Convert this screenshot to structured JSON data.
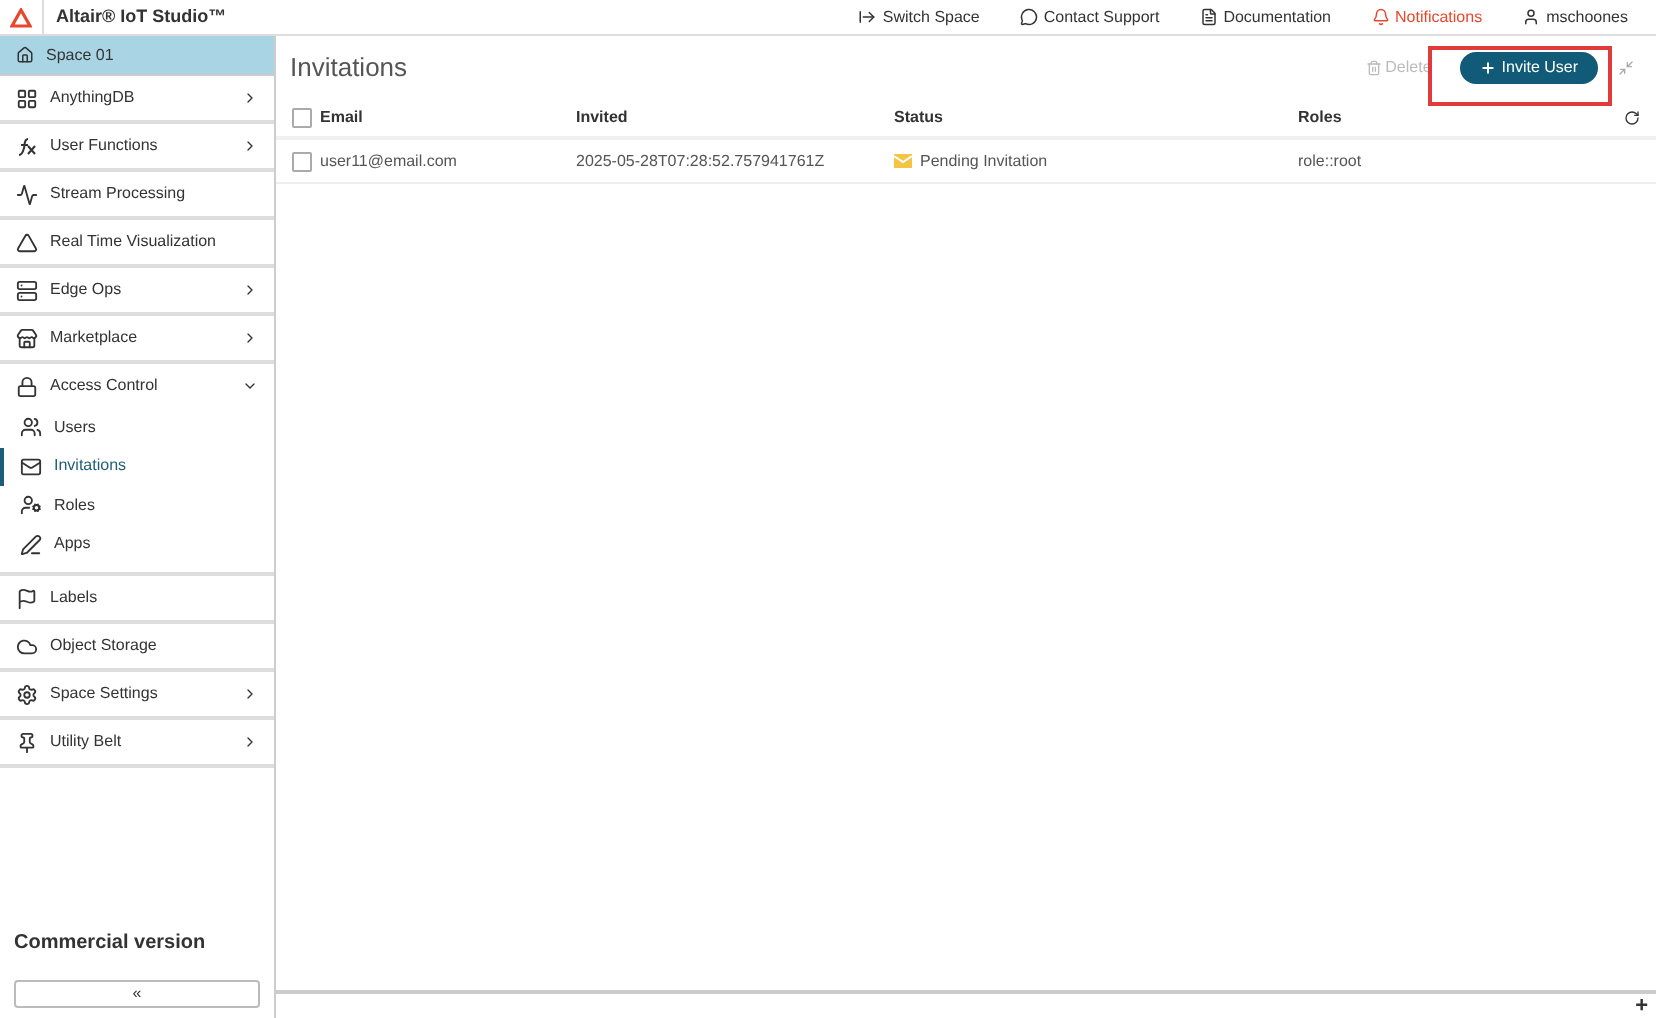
{
  "app": {
    "title": "Altair® IoT Studio™"
  },
  "top_nav": [
    {
      "label": "Switch Space",
      "kind": "switch",
      "alert": false
    },
    {
      "label": "Contact Support",
      "kind": "support",
      "alert": false
    },
    {
      "label": "Documentation",
      "kind": "docs",
      "alert": false
    },
    {
      "label": "Notifications",
      "kind": "bell",
      "alert": true
    },
    {
      "label": "mschoones",
      "kind": "user",
      "alert": false
    }
  ],
  "space": {
    "label": "Space 01"
  },
  "sidebar": {
    "items": [
      {
        "label": "AnythingDB",
        "kind": "db",
        "expandable": true,
        "expanded": false
      },
      {
        "label": "User Functions",
        "kind": "fx",
        "expandable": true,
        "expanded": false
      },
      {
        "label": "Stream Processing",
        "kind": "stream",
        "expandable": false
      },
      {
        "label": "Real Time Visualization",
        "kind": "viz",
        "expandable": false
      },
      {
        "label": "Edge Ops",
        "kind": "edge",
        "expandable": true,
        "expanded": false
      },
      {
        "label": "Marketplace",
        "kind": "market",
        "expandable": true,
        "expanded": false
      },
      {
        "label": "Access Control",
        "kind": "lock",
        "expandable": true,
        "expanded": true,
        "children": [
          {
            "label": "Users",
            "kind": "users",
            "selected": false
          },
          {
            "label": "Invitations",
            "kind": "mail",
            "selected": true
          },
          {
            "label": "Roles",
            "kind": "roles",
            "selected": false
          },
          {
            "label": "Apps",
            "kind": "apps",
            "selected": false
          }
        ]
      },
      {
        "label": "Labels",
        "kind": "flag",
        "expandable": false
      },
      {
        "label": "Object Storage",
        "kind": "cloud",
        "expandable": false
      },
      {
        "label": "Space Settings",
        "kind": "gear",
        "expandable": true,
        "expanded": false
      },
      {
        "label": "Utility Belt",
        "kind": "pin",
        "expandable": true,
        "expanded": false
      }
    ],
    "footer": "Commercial version",
    "collapse": "«"
  },
  "page": {
    "title": "Invitations",
    "delete_label": "Delete",
    "delete_disabled": true,
    "invite_label": "Invite User",
    "highlight": true
  },
  "table": {
    "all_checked": false,
    "columns": [
      "Email",
      "Invited",
      "Status",
      "Roles"
    ],
    "rows": [
      {
        "checked": false,
        "email": "user11@email.com",
        "invited": "2025-05-28T07:28:52.757941761Z",
        "status": "Pending Invitation",
        "roles": "role::root"
      }
    ]
  },
  "bottom": {
    "add": "+"
  }
}
